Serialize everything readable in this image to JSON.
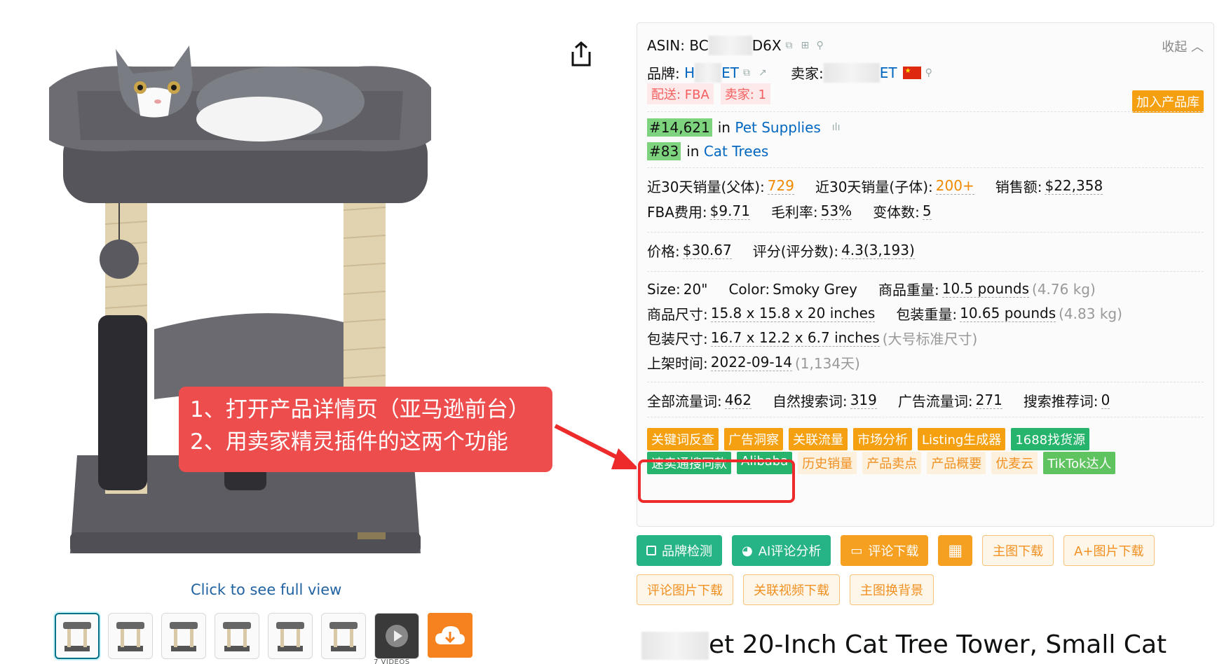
{
  "product": {
    "view_full": "Click to see full view",
    "video_count": "7 VIDEOS",
    "title_visible": "et 20-Inch Cat Tree Tower, Small Cat"
  },
  "thumbs": [
    "thumb-1",
    "thumb-2",
    "thumb-3",
    "thumb-4",
    "thumb-5",
    "thumb-6",
    "video"
  ],
  "callout": {
    "line1": "1、打开产品详情页（亚马逊前台）",
    "line2": "2、用卖家精灵插件的这两个功能"
  },
  "panel": {
    "collapse": "收起",
    "asin_label": "ASIN:",
    "asin_prefix": "BC",
    "asin_suffix": "D6X",
    "brand_label": "品牌:",
    "brand_prefix": "H",
    "brand_suffix": "ET",
    "seller_label": "卖家:",
    "seller_suffix": "ET",
    "delivery": "配送: FBA",
    "sellers": "卖家: 1",
    "add_library": "加入产品库",
    "rank1_badge": "#14,621",
    "rank1_in": "in",
    "rank1_cat": "Pet Supplies",
    "rank2_badge": "#83",
    "rank2_in": "in",
    "rank2_cat": "Cat Trees",
    "sales_parent_label": "近30天销量(父体):",
    "sales_parent": "729",
    "sales_child_label": "近30天销量(子体):",
    "sales_child": "200+",
    "revenue_label": "销售额:",
    "revenue": "$22,358",
    "fba_label": "FBA费用:",
    "fba": "$9.71",
    "margin_label": "毛利率:",
    "margin": "53%",
    "variants_label": "变体数:",
    "variants": "5",
    "price_label": "价格:",
    "price": "$30.67",
    "rating_label": "评分(评分数):",
    "rating": "4.3(3,193)",
    "size_label": "Size:",
    "size": "20\"",
    "color_label": "Color:",
    "color": "Smoky Grey",
    "weight_label": "商品重量:",
    "weight": "10.5 pounds",
    "weight_kg": "(4.76 kg)",
    "dims_label": "商品尺寸:",
    "dims": "15.8 x 15.8 x 20 inches",
    "pkg_weight_label": "包装重量:",
    "pkg_weight": "10.65 pounds",
    "pkg_weight_kg": "(4.83 kg)",
    "pkg_dims_label": "包装尺寸:",
    "pkg_dims": "16.7 x 12.2 x 6.7 inches",
    "pkg_dims_note": "(大号标准尺寸)",
    "listed_label": "上架时间:",
    "listed": "2022-09-14",
    "listed_days": "(1,134天)",
    "kw_all_label": "全部流量词:",
    "kw_all": "462",
    "kw_organic_label": "自然搜索词:",
    "kw_organic": "319",
    "kw_ads_label": "广告流量词:",
    "kw_ads": "271",
    "kw_rec_label": "搜索推荐词:",
    "kw_rec": "0"
  },
  "tools_row1": [
    {
      "label": "关键词反查",
      "style": "orange"
    },
    {
      "label": "广告洞察",
      "style": "orange"
    },
    {
      "label": "关联流量",
      "style": "orange"
    },
    {
      "label": "市场分析",
      "style": "orange"
    },
    {
      "label": "Listing生成器",
      "style": "orange"
    },
    {
      "label": "1688找货源",
      "style": "green"
    }
  ],
  "tools_row2": [
    {
      "label": "速卖通搜同款",
      "style": "green"
    },
    {
      "label": "Alibaba",
      "style": "green"
    },
    {
      "label": "历史销量",
      "style": "soft-orange"
    },
    {
      "label": "产品卖点",
      "style": "soft-orange"
    },
    {
      "label": "产品概要",
      "style": "soft-orange"
    },
    {
      "label": "优麦云",
      "style": "soft-orange"
    },
    {
      "label": "TikTok达人",
      "style": "lgreen"
    }
  ],
  "actions_row1": [
    {
      "label": "品牌检测",
      "icon": "square-icon",
      "style": "green"
    },
    {
      "label": "AI评论分析",
      "icon": "pie-icon",
      "style": "green"
    },
    {
      "label": "评论下载",
      "icon": "comment-icon",
      "style": "orange"
    },
    {
      "label": "",
      "icon": "calculator-icon",
      "style": "orange"
    },
    {
      "label": "主图下载",
      "icon": "",
      "style": "outline"
    },
    {
      "label": "A+图片下载",
      "icon": "",
      "style": "outline"
    }
  ],
  "actions_row2": [
    {
      "label": "评论图片下载",
      "style": "outline"
    },
    {
      "label": "关联视频下载",
      "style": "outline"
    },
    {
      "label": "主图换背景",
      "style": "outline"
    }
  ]
}
